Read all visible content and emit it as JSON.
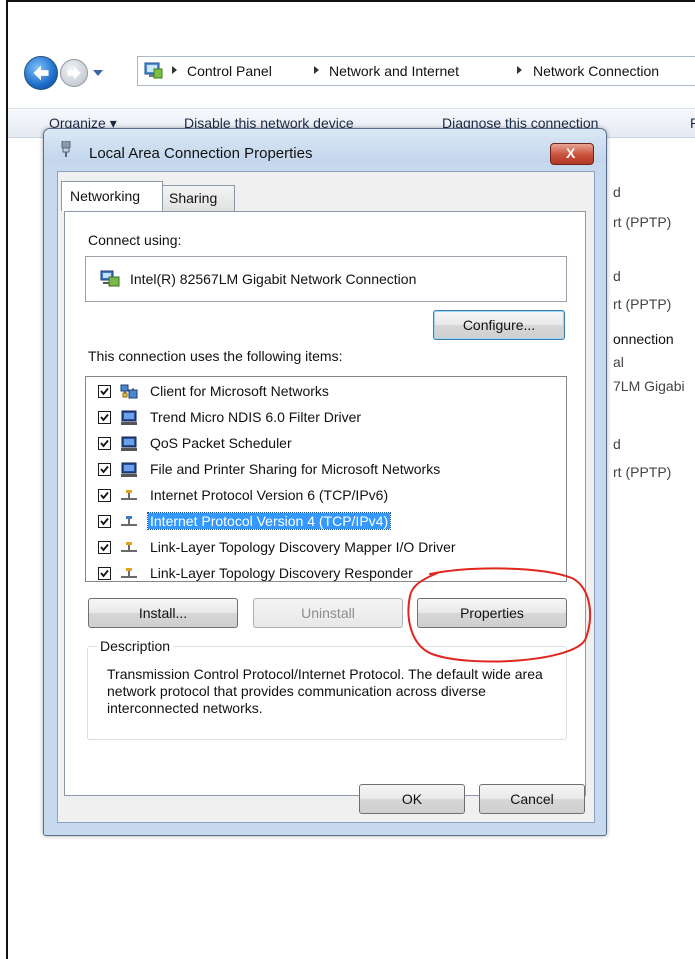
{
  "explorer": {
    "breadcrumb": [
      "Control Panel",
      "Network and Internet",
      "Network Connection"
    ],
    "commands": [
      "Organize ▾",
      "Disable this network device",
      "Diagnose this connection",
      "R"
    ],
    "background_items": [
      {
        "label": "d"
      },
      {
        "label": "rt (PPTP)"
      },
      {
        "label": "d"
      },
      {
        "label": "rt (PPTP)"
      },
      {
        "label": "onnection"
      },
      {
        "label": "al"
      },
      {
        "label": "7LM Gigabi"
      },
      {
        "label": "d"
      },
      {
        "label": "rt (PPTP)"
      }
    ]
  },
  "dialog": {
    "title": "Local Area Connection Properties",
    "close_label": "X",
    "tabs": [
      {
        "label": "Networking",
        "active": true
      },
      {
        "label": "Sharing",
        "active": false
      }
    ],
    "connect_using_label": "Connect using:",
    "adapter_name": "Intel(R) 82567LM Gigabit Network Connection",
    "configure_label": "Configure...",
    "items_label": "This connection uses the following items:",
    "items": [
      {
        "label": "Client for Microsoft Networks",
        "checked": true,
        "icon": "network-client-icon",
        "selected": false
      },
      {
        "label": "Trend Micro NDIS 6.0 Filter Driver",
        "checked": true,
        "icon": "computer-service-icon",
        "selected": false
      },
      {
        "label": "QoS Packet Scheduler",
        "checked": true,
        "icon": "computer-service-icon",
        "selected": false
      },
      {
        "label": "File and Printer Sharing for Microsoft Networks",
        "checked": true,
        "icon": "computer-service-icon",
        "selected": false
      },
      {
        "label": "Internet Protocol Version 6 (TCP/IPv6)",
        "checked": true,
        "icon": "protocol-icon",
        "selected": false
      },
      {
        "label": "Internet Protocol Version 4 (TCP/IPv4)",
        "checked": true,
        "icon": "protocol-icon",
        "selected": true
      },
      {
        "label": "Link-Layer Topology Discovery Mapper I/O Driver",
        "checked": true,
        "icon": "protocol-icon",
        "selected": false
      },
      {
        "label": "Link-Layer Topology Discovery Responder",
        "checked": true,
        "icon": "protocol-icon",
        "selected": false
      }
    ],
    "install_label": "Install...",
    "uninstall_label": "Uninstall",
    "properties_label": "Properties",
    "description_legend": "Description",
    "description_text": "Transmission Control Protocol/Internet Protocol. The default wide area network protocol that provides communication across diverse interconnected networks.",
    "ok_label": "OK",
    "cancel_label": "Cancel"
  },
  "colors": {
    "selection": "#3399ff",
    "annotation": "#e0261e",
    "dialog_frame": "#c7d9ee"
  }
}
